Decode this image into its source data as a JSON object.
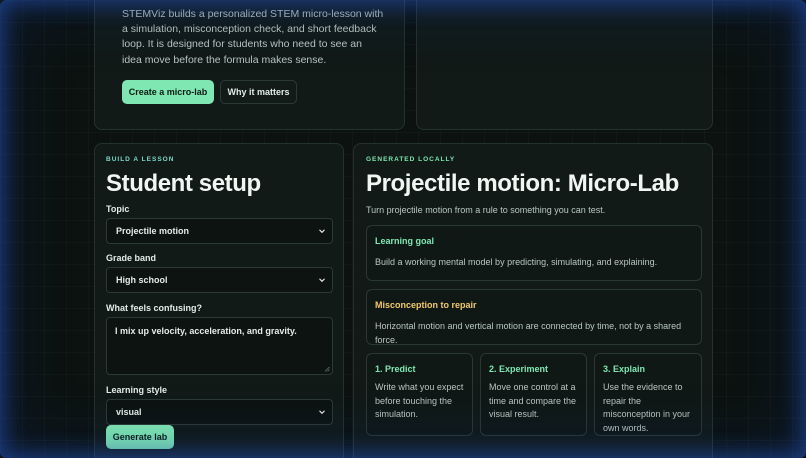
{
  "hero": {
    "description": "STEMViz builds a personalized STEM micro-lesson with a simulation, misconception check, and short feedback loop. It is designed for students who need to see an idea move before the formula makes sense.",
    "primary_button": "Create a micro-lab",
    "secondary_button": "Why it matters"
  },
  "setup": {
    "eyebrow": "BUILD A LESSON",
    "title": "Student setup",
    "topic_label": "Topic",
    "topic_value": "Projectile motion",
    "grade_label": "Grade band",
    "grade_value": "High school",
    "confusing_label": "What feels confusing?",
    "confusing_value": "I mix up velocity, acceleration, and gravity.",
    "style_label": "Learning style",
    "style_value": "visual",
    "generate_button": "Generate lab"
  },
  "lab": {
    "eyebrow": "GENERATED LOCALLY",
    "title": "Projectile motion: Micro-Lab",
    "subtitle": "Turn projectile motion from a rule to something you can test.",
    "goal_title": "Learning goal",
    "goal_body": "Build a working mental model by predicting, simulating, and explaining.",
    "misconception_title": "Misconception to repair",
    "misconception_body": "Horizontal motion and vertical motion are connected by time, not by a shared force.",
    "steps": [
      {
        "title": "1. Predict",
        "body": "Write what you expect before touching the simulation."
      },
      {
        "title": "2. Experiment",
        "body": "Move one control at a time and compare the visual result."
      },
      {
        "title": "3. Explain",
        "body": "Use the evidence to repair the misconception in your own words."
      }
    ]
  },
  "colors": {
    "accent": "#7fe8b2",
    "eyebrow": "#7fd6c8",
    "warning": "#f2c96b",
    "background": "#0b1210"
  },
  "icons": {
    "select_chevron": "chevron-down-icon",
    "textarea_grip": "resize-grip-icon"
  }
}
